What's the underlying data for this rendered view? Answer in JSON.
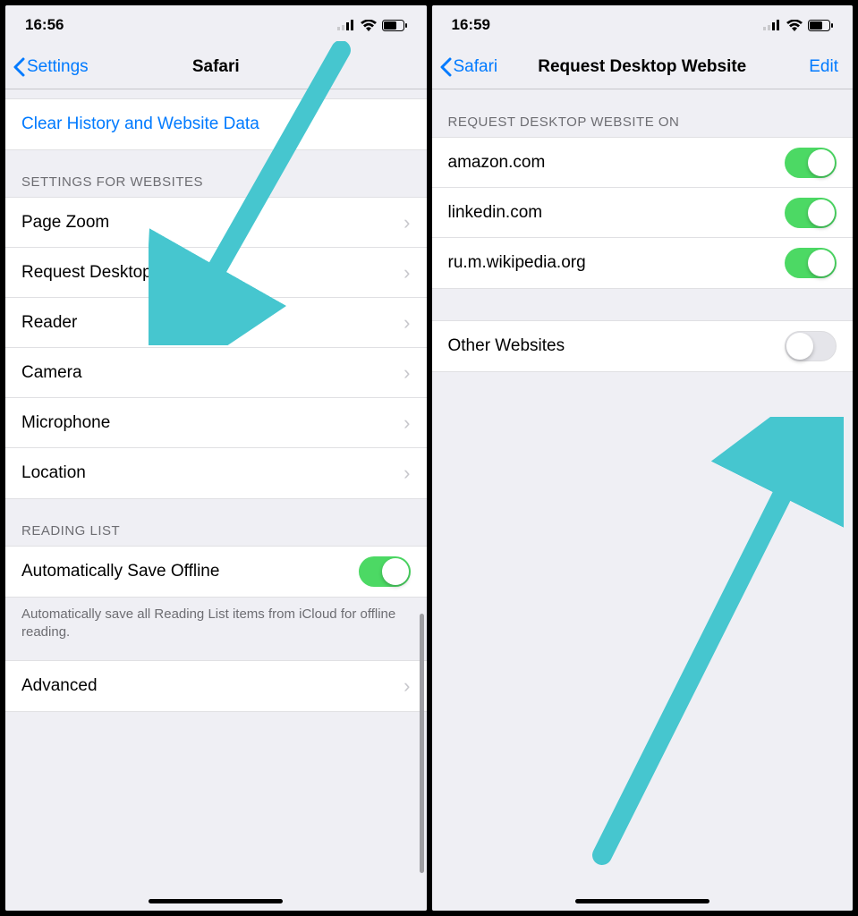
{
  "left": {
    "status": {
      "time": "16:56"
    },
    "nav": {
      "back": "Settings",
      "title": "Safari"
    },
    "clear_history": "Clear History and Website Data",
    "section_websites": "SETTINGS FOR WEBSITES",
    "items": {
      "page_zoom": "Page Zoom",
      "request_desktop": "Request Desktop Website",
      "reader": "Reader",
      "camera": "Camera",
      "microphone": "Microphone",
      "location": "Location"
    },
    "section_reading": "READING LIST",
    "auto_save": "Automatically Save Offline",
    "auto_save_footer": "Automatically save all Reading List items from iCloud for offline reading.",
    "advanced": "Advanced"
  },
  "right": {
    "status": {
      "time": "16:59"
    },
    "nav": {
      "back": "Safari",
      "title": "Request Desktop Website",
      "edit": "Edit"
    },
    "section_on": "REQUEST DESKTOP WEBSITE ON",
    "sites": [
      {
        "domain": "amazon.com",
        "on": true
      },
      {
        "domain": "linkedin.com",
        "on": true
      },
      {
        "domain": "ru.m.wikipedia.org",
        "on": true
      }
    ],
    "other_websites": "Other Websites",
    "other_on": false
  },
  "colors": {
    "accent": "#007aff",
    "toggle_on": "#4cd964",
    "arrow": "#46c6cf"
  }
}
